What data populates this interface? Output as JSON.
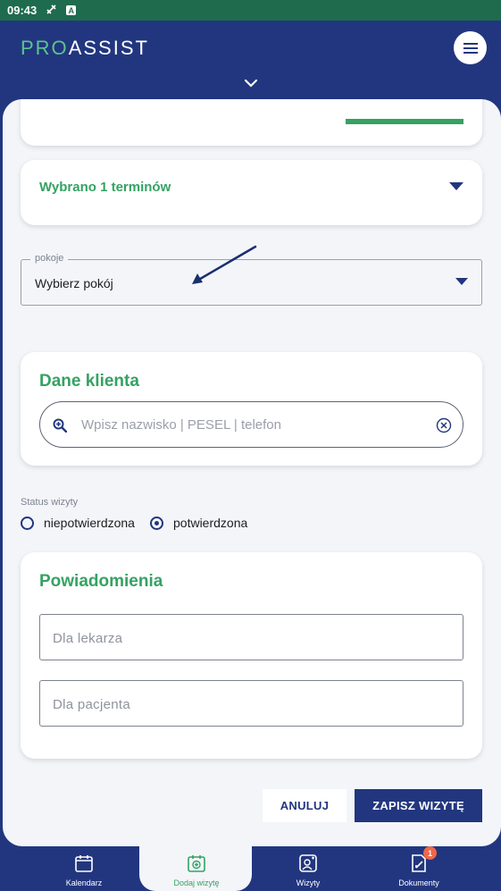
{
  "status_bar": {
    "time": "09:43"
  },
  "header": {
    "logo_part1": "PRO",
    "logo_part2": "ASSIST"
  },
  "terms": {
    "label": "Wybrano 1 terminów"
  },
  "rooms": {
    "legend": "pokoje",
    "value": "Wybierz pokój"
  },
  "client": {
    "title": "Dane klienta",
    "search_placeholder": "Wpisz nazwisko | PESEL | telefon"
  },
  "visit_status": {
    "label": "Status wizyty",
    "options": [
      {
        "label": "niepotwierdzona",
        "checked": false
      },
      {
        "label": "potwierdzona",
        "checked": true
      }
    ]
  },
  "notifications": {
    "title": "Powiadomienia",
    "doctor_placeholder": "Dla lekarza",
    "patient_placeholder": "Dla pacjenta"
  },
  "actions": {
    "cancel_label": "ANULUJ",
    "save_label": "ZAPISZ WIZYTĘ"
  },
  "bottom_nav": {
    "items": [
      {
        "label": "Kalendarz",
        "icon": "calendar-icon",
        "active": false
      },
      {
        "label": "Dodaj wizytę",
        "icon": "calendar-add-icon",
        "active": true
      },
      {
        "label": "Wizyty",
        "icon": "visits-icon",
        "active": false
      },
      {
        "label": "Dokumenty",
        "icon": "documents-icon",
        "active": false,
        "badge": "1"
      }
    ]
  },
  "colors": {
    "primary": "#22367f",
    "accent_green": "#35a263",
    "badge": "#f0674a",
    "statusbar": "#1f6b4e"
  }
}
